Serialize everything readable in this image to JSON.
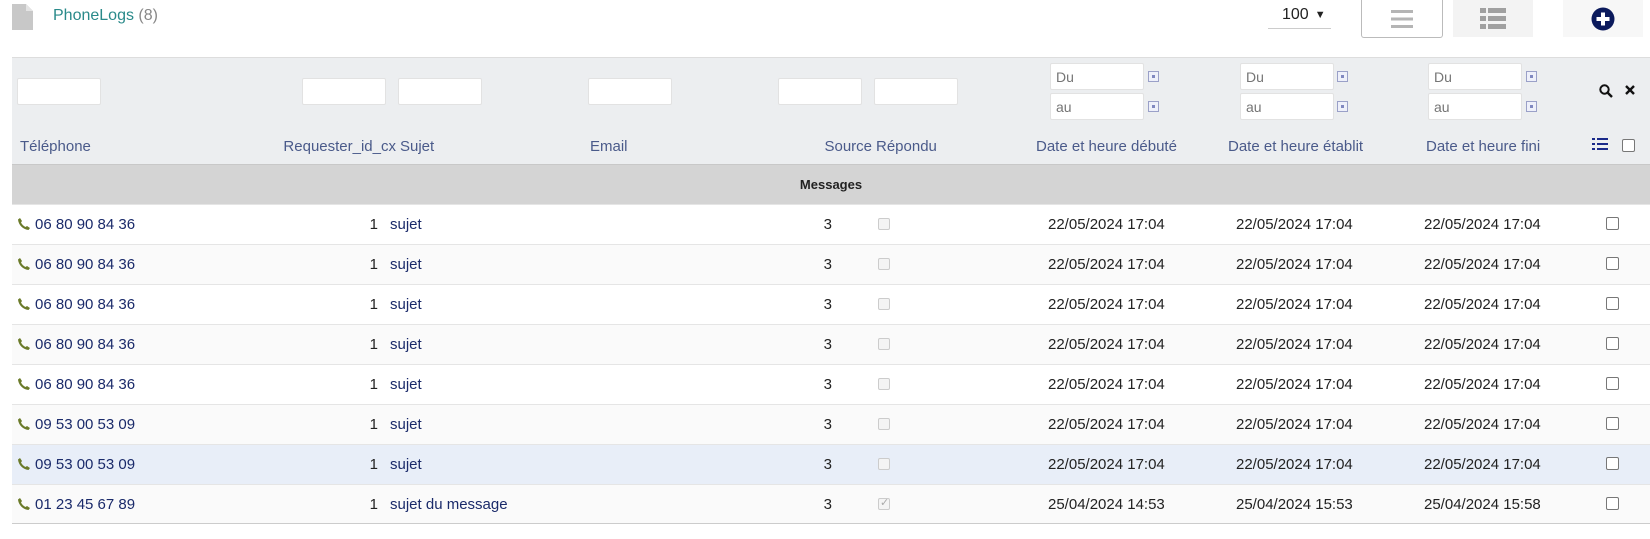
{
  "header": {
    "title": "PhoneLogs",
    "count": "(8)",
    "per_page": "100",
    "icons": {
      "doc": "document-icon",
      "list": "list-view-icon",
      "detail": "detail-view-icon",
      "add": "plus-circle-icon"
    }
  },
  "filters": {
    "date_from_placeholder": "Du",
    "date_to_placeholder": "au"
  },
  "columns": {
    "telephone": "Téléphone",
    "requester": "Requester_id_cx",
    "sujet": "Sujet",
    "email": "Email",
    "source": "Source",
    "repondu": "Répondu",
    "debut": "Date et heure débuté",
    "etablit": "Date et heure établit",
    "fini": "Date et heure fini"
  },
  "group_label": "Messages",
  "rows": [
    {
      "telephone": "06 80 90 84 36",
      "requester": "1",
      "sujet": "sujet",
      "email": "",
      "source": "3",
      "repondu": false,
      "debut": "22/05/2024 17:04",
      "etablit": "22/05/2024 17:04",
      "fini": "22/05/2024 17:04"
    },
    {
      "telephone": "06 80 90 84 36",
      "requester": "1",
      "sujet": "sujet",
      "email": "",
      "source": "3",
      "repondu": false,
      "debut": "22/05/2024 17:04",
      "etablit": "22/05/2024 17:04",
      "fini": "22/05/2024 17:04"
    },
    {
      "telephone": "06 80 90 84 36",
      "requester": "1",
      "sujet": "sujet",
      "email": "",
      "source": "3",
      "repondu": false,
      "debut": "22/05/2024 17:04",
      "etablit": "22/05/2024 17:04",
      "fini": "22/05/2024 17:04"
    },
    {
      "telephone": "06 80 90 84 36",
      "requester": "1",
      "sujet": "sujet",
      "email": "",
      "source": "3",
      "repondu": false,
      "debut": "22/05/2024 17:04",
      "etablit": "22/05/2024 17:04",
      "fini": "22/05/2024 17:04"
    },
    {
      "telephone": "06 80 90 84 36",
      "requester": "1",
      "sujet": "sujet",
      "email": "",
      "source": "3",
      "repondu": false,
      "debut": "22/05/2024 17:04",
      "etablit": "22/05/2024 17:04",
      "fini": "22/05/2024 17:04"
    },
    {
      "telephone": "09 53 00 53 09",
      "requester": "1",
      "sujet": "sujet",
      "email": "",
      "source": "3",
      "repondu": false,
      "debut": "22/05/2024 17:04",
      "etablit": "22/05/2024 17:04",
      "fini": "22/05/2024 17:04"
    },
    {
      "telephone": "09 53 00 53 09",
      "requester": "1",
      "sujet": "sujet",
      "email": "",
      "source": "3",
      "repondu": false,
      "debut": "22/05/2024 17:04",
      "etablit": "22/05/2024 17:04",
      "fini": "22/05/2024 17:04"
    },
    {
      "telephone": "01 23 45 67 89",
      "requester": "1",
      "sujet": "sujet du message",
      "email": "",
      "source": "3",
      "repondu": true,
      "debut": "25/04/2024 14:53",
      "etablit": "25/04/2024 15:53",
      "fini": "25/04/2024 15:58"
    }
  ],
  "colors": {
    "title": "#2a8a8a",
    "header_text": "#4a5a8a",
    "link_text": "#1a2a6a",
    "phone_icon": "#6b7b2a",
    "group_bg": "#d4d4d4"
  }
}
